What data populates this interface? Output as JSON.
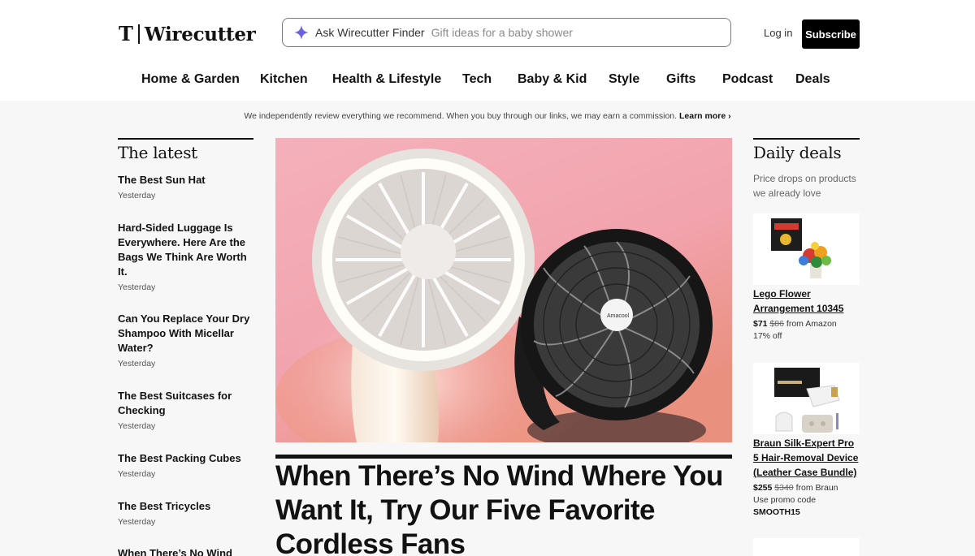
{
  "header": {
    "logo_text": "Wirecutter",
    "logo_mark": "T",
    "finder_label": "Ask Wirecutter Finder",
    "finder_placeholder": "Gift ideas for a baby shower",
    "login": "Log in",
    "subscribe": "Subscribe"
  },
  "nav": [
    "Home & Garden",
    "Kitchen",
    "Health & Lifestyle",
    "Tech",
    "Baby & Kid",
    "Style",
    "Gifts",
    "Podcast",
    "Deals"
  ],
  "disclosure": {
    "text": "We independently review everything we recommend. When you buy through our links, we may earn a commission.",
    "link": "Learn more ›"
  },
  "latest": {
    "heading": "The latest",
    "items": [
      {
        "title": "The Best Sun Hat",
        "date": "Yesterday"
      },
      {
        "title": "Hard-Sided Luggage Is Everywhere. Here Are the Bags We Think Are Worth It.",
        "date": "Yesterday"
      },
      {
        "title": "Can You Replace Your Dry Shampoo With Micellar Water?",
        "date": "Yesterday"
      },
      {
        "title": "The Best Suitcases for Checking",
        "date": "Yesterday"
      },
      {
        "title": "The Best Packing Cubes",
        "date": "Yesterday"
      },
      {
        "title": "The Best Tricycles",
        "date": "Yesterday"
      },
      {
        "title": "When There’s No Wind",
        "date": ""
      }
    ]
  },
  "feature": {
    "headline": "When There’s No Wind Where You Want It, Try Our Five Favorite Cordless Fans",
    "image_alt": "A white ring-light fan and a black clip fan on a pink background",
    "fan_brand": "Amacool"
  },
  "deals": {
    "heading": "Daily deals",
    "subheading": "Price drops on products we already love",
    "items": [
      {
        "title": "Lego Flower Arrangement 10345",
        "price": "$71",
        "was": "$86",
        "source": "from Amazon",
        "extra": "17% off",
        "code": ""
      },
      {
        "title": "Braun Silk-Expert Pro 5 Hair-Removal Device (Leather Case Bundle)",
        "price": "$255",
        "was": "$340",
        "source": "from Braun",
        "extra": "Use promo code",
        "code": "SMOOTH15"
      }
    ]
  },
  "colors": {
    "finder_spark": "#6b63d9",
    "hero_bg": "#f3a9b3",
    "subscribe_bg": "#000000"
  }
}
